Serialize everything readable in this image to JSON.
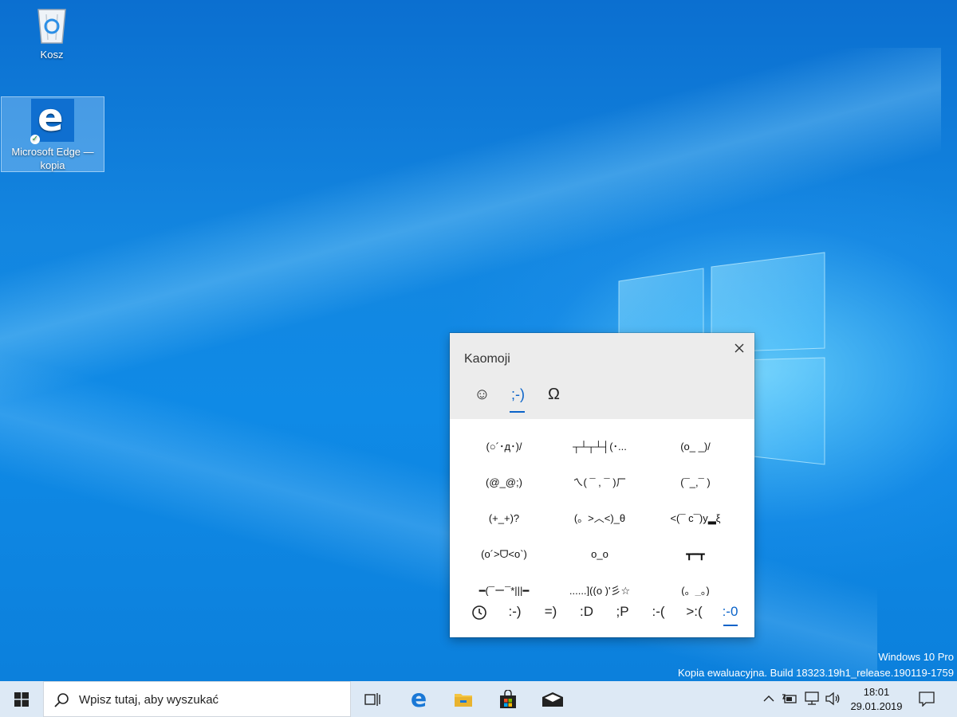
{
  "desktop": {
    "icons": [
      {
        "label": "Kosz"
      },
      {
        "label": "Microsoft Edge — kopia"
      }
    ],
    "watermark_line1": "Windows 10 Pro",
    "watermark_line2": "Kopia ewaluacyjna. Build 18323.19h1_release.190119-1759"
  },
  "kaomoji_panel": {
    "title": "Kaomoji",
    "category_tabs": [
      {
        "icon": "smiley-icon",
        "label": "☺"
      },
      {
        "icon": "kaomoji-tab",
        "label": ";-)"
      },
      {
        "icon": "omega-symbol-icon",
        "label": "Ω"
      }
    ],
    "active_category": 1,
    "items": [
      "(○´･д･)/",
      "┬┴┬┴┤(･...",
      "(o_ _)/",
      "(@_@;)",
      "ㄟ( ¯ , ¯ )ㄏ",
      "(¯_,¯ )",
      "(+_+)?",
      "(。>︿<)_θ",
      "<(¯ c¯)y▂ξ",
      "(o´>ᗜ<o`)",
      "o_o",
      "┳━┳",
      "━(¯ー¯*|||━",
      "......]((o )'彡☆",
      "(。_。)"
    ],
    "bottom_tabs": [
      {
        "icon": "recent-clock-icon",
        "label": ""
      },
      {
        "label": ":-)"
      },
      {
        "label": "=)"
      },
      {
        "label": ":D"
      },
      {
        "label": ";P"
      },
      {
        "label": ":-("
      },
      {
        "label": ">:("
      },
      {
        "label": ":-0"
      }
    ],
    "active_bottom_tab": 7
  },
  "taskbar": {
    "search_placeholder": "Wpisz tutaj, aby wyszukać",
    "pinned": [
      "task-view-icon",
      "edge-icon",
      "file-explorer-icon",
      "store-icon",
      "mail-icon"
    ],
    "tray_icons": [
      "chevron-up-icon",
      "battery-icon",
      "network-icon",
      "volume-icon"
    ],
    "time": "18:01",
    "date": "29.01.2019",
    "notification_icon": "action-center-icon"
  },
  "colors": {
    "accent": "#0a63c9",
    "taskbar_bg": "#dde9f5",
    "panel_header": "#ececec"
  }
}
